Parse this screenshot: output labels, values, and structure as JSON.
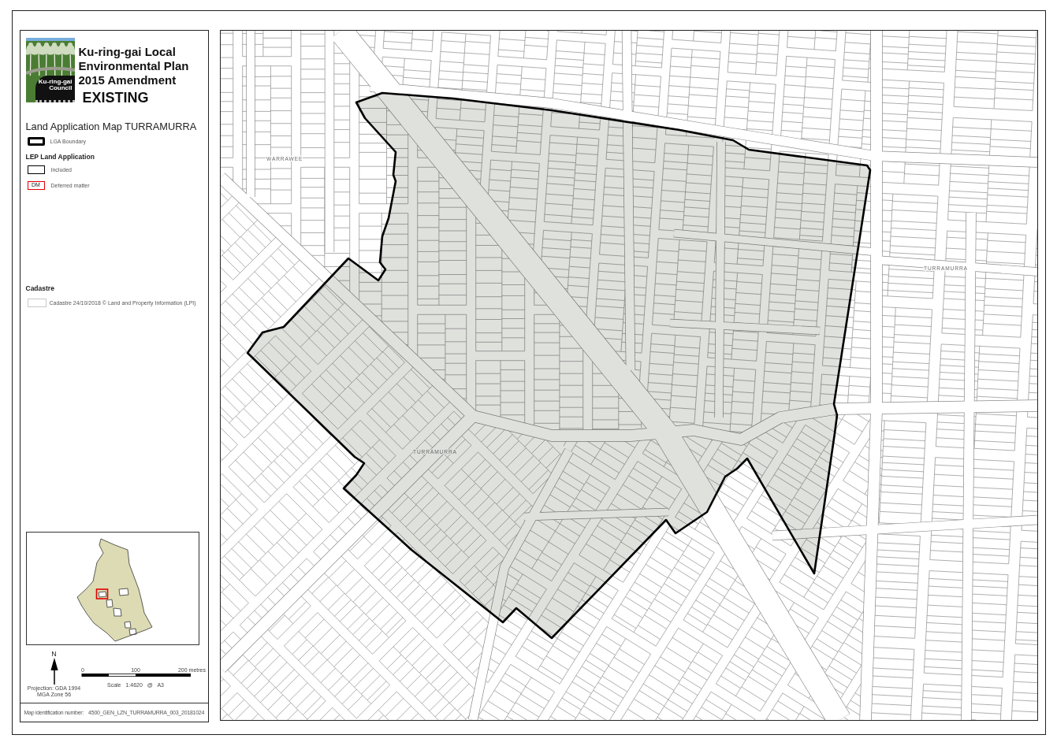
{
  "legend": {
    "logo": {
      "lines": [
        "Ku-ring-gai",
        "Council"
      ]
    },
    "title": "Ku-ring-gai Local Environmental Plan 2015 Amendment",
    "status": "EXISTING",
    "map_name": "Land Application Map TURRAMURRA",
    "sections": [
      {
        "items": [
          {
            "kind": "boundary",
            "label": "LGA Boundary"
          }
        ]
      },
      {
        "heading": "LEP Land Application",
        "items": [
          {
            "kind": "included",
            "label": "Included"
          },
          {
            "kind": "deferred",
            "code": "DM",
            "label": "Deferred matter"
          }
        ]
      },
      {
        "heading": "Cadastre",
        "items": [
          {
            "kind": "cadastre",
            "label": "Cadastre 24/10/2018 © Land and Property Information (LPI)"
          }
        ]
      }
    ],
    "north_label": "N",
    "scale_labels": [
      "0",
      "100",
      "200 metres"
    ],
    "scale_text": "Scale 1:4620 @ A3",
    "projection": [
      "Projection: GDA 1994",
      "MGA Zone 56"
    ],
    "map_id": {
      "label": "Map identification number:",
      "value": "4500_GEN_LZN_TURRAMURRA_003_20181024"
    }
  },
  "map": {
    "place_labels": [
      "WARRAWEE",
      "TURRAMURRA",
      "TURRAMURRA"
    ]
  }
}
